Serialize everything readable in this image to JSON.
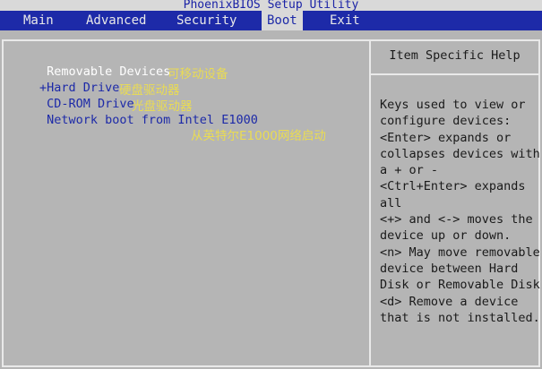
{
  "title": "PhoenixBIOS Setup Utility",
  "menu": [
    "Main",
    "Advanced",
    "Security",
    "Boot",
    "Exit"
  ],
  "active_menu": "Boot",
  "boot_items": [
    {
      "label": " Removable Devices",
      "note": "可移动设备",
      "selected": true
    },
    {
      "label": "+Hard Drive",
      "note": "硬盘驱动器",
      "selected": false
    },
    {
      "label": " CD-ROM Drive",
      "note": "光盘驱动器",
      "selected": false
    },
    {
      "label": " Network boot from Intel E1000",
      "note": "从英特尔E1000网络启动",
      "selected": false
    }
  ],
  "help": {
    "title": "Item Specific Help",
    "lines": [
      "Keys used to view or",
      "configure devices:",
      "<Enter> expands or",
      "collapses devices with",
      "a + or -",
      "<Ctrl+Enter> expands",
      "all",
      "<+> and <-> moves the",
      "device up or down.",
      "<n> May move removable",
      "device between Hard",
      "Disk or Removable Disk",
      "<d> Remove a device",
      "that is not installed."
    ]
  },
  "colors": {
    "background": "#b5b5b5",
    "menu_bar": "#1d2aa8",
    "item_text": "#1d2aa8",
    "selected_text": "#ffffff",
    "annotation": "#eadc52"
  }
}
